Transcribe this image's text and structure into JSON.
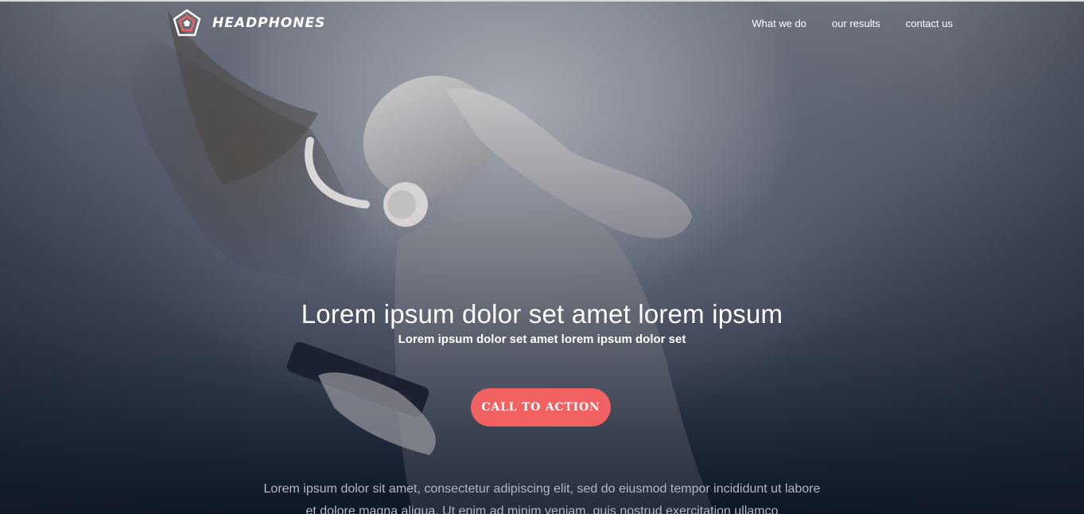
{
  "brand": {
    "name": "HEADPHONES",
    "logo_icon": "pentagon-logo-icon",
    "accent": "#f26161"
  },
  "nav": {
    "items": [
      {
        "label": "What we do"
      },
      {
        "label": "our results"
      },
      {
        "label": "contact us"
      }
    ]
  },
  "hero": {
    "headline": "Lorem ipsum dolor set amet lorem ipsum",
    "subheadline": "Lorem ipsum dolor set amet lorem ipsum dolor set",
    "cta_label": "CALL TO ACTION",
    "cta_color": "#f26161",
    "body": "Lorem ipsum dolor sit amet, consectetur adipiscing elit, sed do eiusmod tempor incididunt ut labore et dolore magna aliqua. Ut enim ad minim veniam, quis nostrud exercitation ullamco",
    "background_image": "woman-listening-headphones-photo"
  }
}
